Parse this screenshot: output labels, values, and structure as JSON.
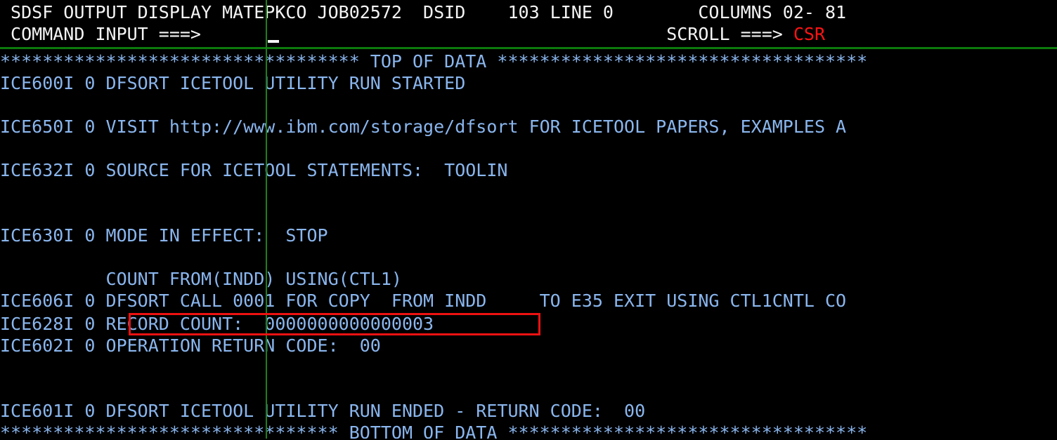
{
  "terminal": {
    "title": "SDSF OUTPUT DISPLAY",
    "job_owner": "MATEPKCO",
    "job_id": "JOB02572",
    "dsid_label": "DSID",
    "dsid_value": "103",
    "line_label": "LINE",
    "line_value": "0",
    "columns_label": "COLUMNS",
    "columns_value": "02- 81",
    "command_label": "COMMAND INPUT ===>",
    "command_value": "",
    "scroll_label": "SCROLL ===>",
    "scroll_value": "CSR",
    "header_line_1": " SDSF OUTPUT DISPLAY MATEPKCO JOB02572  DSID    103 LINE 0        COLUMNS 02- 81",
    "header_line_2": " COMMAND INPUT ===>                                            SCROLL ===> ",
    "colors": {
      "background": "#000000",
      "header_text": "#f4f4f4",
      "body_text": "#8ab6ee",
      "scroll_value": "#ff1414",
      "rule_green": "#1e7f1e",
      "highlight_red": "#ee1111"
    }
  },
  "output": {
    "top_of_data": "********************************** TOP OF DATA ***********************************",
    "bottom_of_data": "******************************** BOTTOM OF DATA **********************************",
    "lines": [
      "ICE600I 0 DFSORT ICETOOL UTILITY RUN STARTED",
      "",
      "ICE650I 0 VISIT http://www.ibm.com/storage/dfsort FOR ICETOOL PAPERS, EXAMPLES A",
      "",
      "ICE632I 0 SOURCE FOR ICETOOL STATEMENTS:  TOOLIN",
      "",
      "",
      "ICE630I 0 MODE IN EFFECT:  STOP",
      "",
      "          COUNT FROM(INDD) USING(CTL1)",
      "ICE606I 0 DFSORT CALL 0001 FOR COPY  FROM INDD     TO E35 EXIT USING CTL1CNTL CO",
      "ICE628I 0 RECORD COUNT:  0000000000000003",
      "ICE602I 0 OPERATION RETURN CODE:  00",
      "",
      "",
      "ICE601I 0 DFSORT ICETOOL UTILITY RUN ENDED - RETURN CODE:  00"
    ]
  },
  "annotation": {
    "record_count_label": "RECORD COUNT:",
    "record_count_value": "0000000000000003",
    "highlight_target": "ICE628I RECORD COUNT"
  }
}
